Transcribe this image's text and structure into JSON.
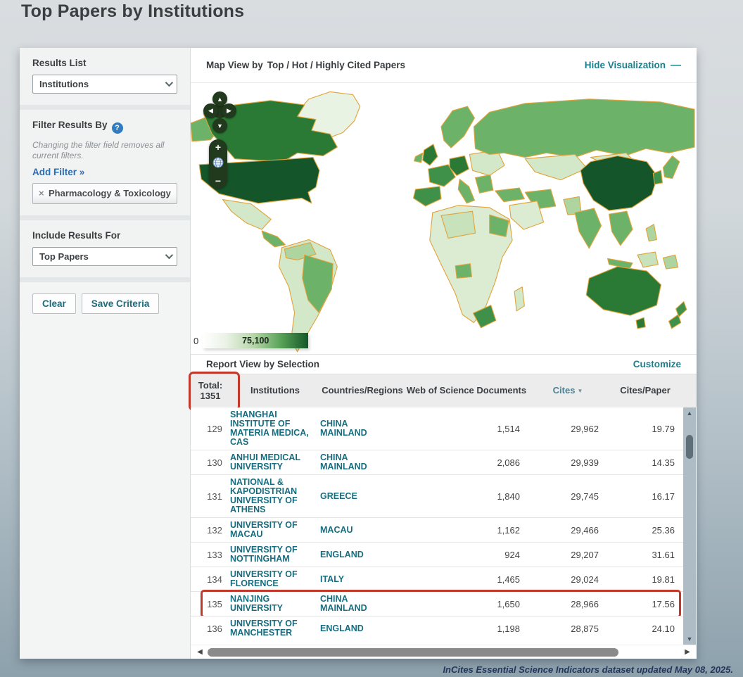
{
  "page": {
    "title": "Top Papers by Institutions"
  },
  "sidebar": {
    "results_list": {
      "label": "Results List",
      "value": "Institutions"
    },
    "filter": {
      "label": "Filter Results By",
      "note": "Changing the filter field removes all current filters.",
      "add_link": "Add Filter »",
      "chip": "Pharmacology & Toxicology"
    },
    "include": {
      "label": "Include Results For",
      "value": "Top Papers"
    },
    "buttons": {
      "clear": "Clear",
      "save": "Save Criteria"
    }
  },
  "map": {
    "title_prefix": "Map View by",
    "title_value": "Top / Hot / Highly Cited Papers",
    "hide_link": "Hide Visualization",
    "legend": {
      "min": "0",
      "max": "75,100"
    }
  },
  "report": {
    "title": "Report View by Selection",
    "customize": "Customize"
  },
  "table": {
    "total_label": "Total:",
    "total_value": "1351",
    "columns": [
      "Institutions",
      "Countries/Regions",
      "Web of Science Documents",
      "Cites",
      "Cites/Paper"
    ],
    "rows": [
      {
        "rank": "129",
        "institution": "SHANGHAI INSTITUTE OF MATERIA MEDICA, CAS",
        "country": "CHINA MAINLAND",
        "docs": "1,514",
        "cites": "29,962",
        "cpp": "19.79",
        "highlighted": false
      },
      {
        "rank": "130",
        "institution": "ANHUI MEDICAL UNIVERSITY",
        "country": "CHINA MAINLAND",
        "docs": "2,086",
        "cites": "29,939",
        "cpp": "14.35",
        "highlighted": false
      },
      {
        "rank": "131",
        "institution": "NATIONAL & KAPODISTRIAN UNIVERSITY OF ATHENS",
        "country": "GREECE",
        "docs": "1,840",
        "cites": "29,745",
        "cpp": "16.17",
        "highlighted": false
      },
      {
        "rank": "132",
        "institution": "UNIVERSITY OF MACAU",
        "country": "MACAU",
        "docs": "1,162",
        "cites": "29,466",
        "cpp": "25.36",
        "highlighted": false
      },
      {
        "rank": "133",
        "institution": "UNIVERSITY OF NOTTINGHAM",
        "country": "ENGLAND",
        "docs": "924",
        "cites": "29,207",
        "cpp": "31.61",
        "highlighted": false
      },
      {
        "rank": "134",
        "institution": "UNIVERSITY OF FLORENCE",
        "country": "ITALY",
        "docs": "1,465",
        "cites": "29,024",
        "cpp": "19.81",
        "highlighted": false
      },
      {
        "rank": "135",
        "institution": "NANJING UNIVERSITY",
        "country": "CHINA MAINLAND",
        "docs": "1,650",
        "cites": "28,966",
        "cpp": "17.56",
        "highlighted": true
      },
      {
        "rank": "136",
        "institution": "UNIVERSITY OF MANCHESTER",
        "country": "ENGLAND",
        "docs": "1,198",
        "cites": "28,875",
        "cpp": "24.10",
        "highlighted": false
      }
    ]
  },
  "footer": {
    "note": "InCites Essential Science Indicators dataset updated May 08, 2025."
  },
  "icons": {
    "help": "?",
    "remove": "×",
    "sort_desc": "▼",
    "collapse": "—",
    "plus": "+",
    "minus": "−",
    "up": "▲",
    "down": "▼",
    "left": "◀",
    "right": "▶"
  },
  "colors": {
    "accent_teal": "#1a7f8e",
    "annotation_red": "#c0392b",
    "map_border": "#e1a33b",
    "map_max_green": "#15552a"
  }
}
